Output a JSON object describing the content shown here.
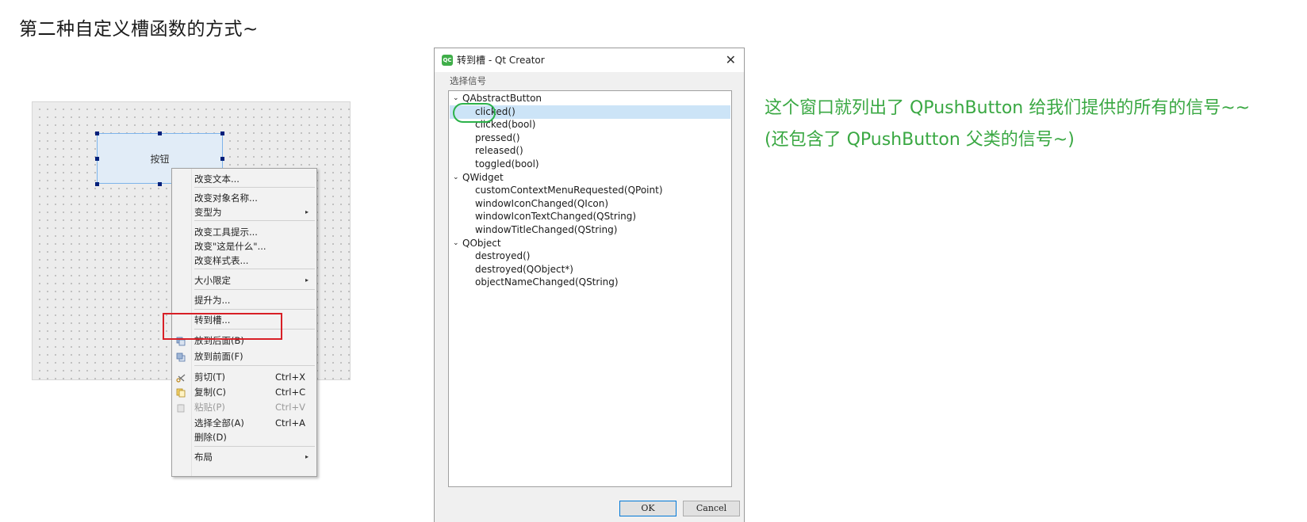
{
  "slide": {
    "title": "第二种自定义槽函数的方式~",
    "notes": [
      "这个窗口就列出了 QPushButton 给我们提供的所有的信号~~",
      "(还包含了 QPushButton 父类的信号~)"
    ]
  },
  "designer": {
    "button_label": "按钮"
  },
  "context_menu": {
    "items": [
      {
        "label": "改变文本..."
      },
      {
        "label": "改变对象名称..."
      },
      {
        "label": "变型为",
        "submenu": true
      },
      {
        "label": "改变工具提示..."
      },
      {
        "label": "改变\"这是什么\"..."
      },
      {
        "label": "改变样式表..."
      },
      {
        "label": "大小限定",
        "submenu": true
      },
      {
        "label": "提升为..."
      },
      {
        "label": "转到槽...",
        "highlighted": true
      },
      {
        "label": "放到后面(B)",
        "icon": "send-to-back-icon"
      },
      {
        "label": "放到前面(F)",
        "icon": "bring-to-front-icon"
      },
      {
        "label": "剪切(T)",
        "shortcut": "Ctrl+X",
        "icon": "scissors-icon"
      },
      {
        "label": "复制(C)",
        "shortcut": "Ctrl+C",
        "icon": "copy-icon"
      },
      {
        "label": "粘贴(P)",
        "shortcut": "Ctrl+V",
        "icon": "paste-icon",
        "disabled": true
      },
      {
        "label": "选择全部(A)",
        "shortcut": "Ctrl+A"
      },
      {
        "label": "删除(D)"
      },
      {
        "label": "布局",
        "submenu": true
      }
    ]
  },
  "dialog": {
    "title": "转到槽 - Qt Creator",
    "group_label": "选择信号",
    "tree": [
      {
        "label": "QAbstractButton",
        "level": 0
      },
      {
        "label": "clicked()",
        "level": 1,
        "selected": true
      },
      {
        "label": "clicked(bool)",
        "level": 1
      },
      {
        "label": "pressed()",
        "level": 1
      },
      {
        "label": "released()",
        "level": 1
      },
      {
        "label": "toggled(bool)",
        "level": 1
      },
      {
        "label": "QWidget",
        "level": 0
      },
      {
        "label": "customContextMenuRequested(QPoint)",
        "level": 1
      },
      {
        "label": "windowIconChanged(QIcon)",
        "level": 1
      },
      {
        "label": "windowIconTextChanged(QString)",
        "level": 1
      },
      {
        "label": "windowTitleChanged(QString)",
        "level": 1
      },
      {
        "label": "QObject",
        "level": 0
      },
      {
        "label": "destroyed()",
        "level": 1
      },
      {
        "label": "destroyed(QObject*)",
        "level": 1
      },
      {
        "label": "objectNameChanged(QString)",
        "level": 1
      }
    ],
    "ok_label": "OK",
    "cancel_label": "Cancel"
  },
  "colors": {
    "accent_green": "#3aa843",
    "highlight_red": "#d81f26",
    "selection_blue": "#cce4f7"
  }
}
